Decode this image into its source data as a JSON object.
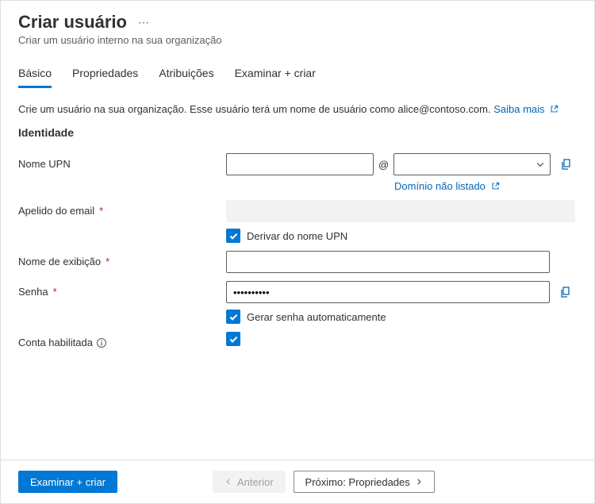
{
  "header": {
    "title": "Criar usuário",
    "subtitle": "Criar um usuário interno na sua organização"
  },
  "tabs": [
    {
      "label": "Básico",
      "active": true
    },
    {
      "label": "Propriedades",
      "active": false
    },
    {
      "label": "Atribuições",
      "active": false
    },
    {
      "label": "Examinar + criar",
      "active": false
    }
  ],
  "intro": {
    "text": "Crie um usuário na sua organização. Esse usuário terá um nome de usuário como alice@contoso.com.",
    "learn_more": "Saiba mais"
  },
  "section_identity": "Identidade",
  "fields": {
    "upn": {
      "label": "Nome UPN",
      "at": "@",
      "domain_not_listed": "Domínio não listado"
    },
    "mail_nickname": {
      "label": "Apelido do email",
      "derive_checkbox": "Derivar do nome UPN"
    },
    "display_name": {
      "label": "Nome de exibição"
    },
    "password": {
      "label": "Senha",
      "value": "••••••••••",
      "auto_checkbox": "Gerar senha automaticamente"
    },
    "account_enabled": {
      "label": "Conta habilitada"
    }
  },
  "footer": {
    "review": "Examinar + criar",
    "previous": "Anterior",
    "next": "Próximo: Propriedades"
  }
}
